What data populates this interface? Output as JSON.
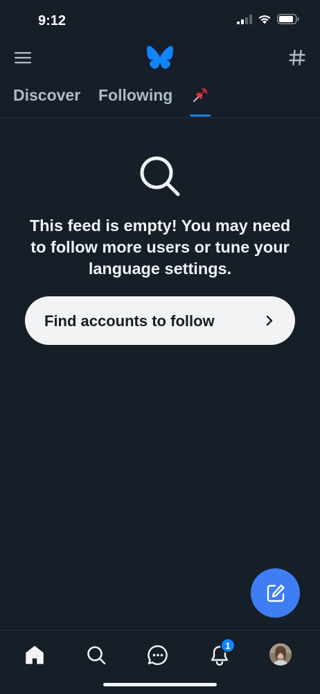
{
  "status_bar": {
    "time": "9:12",
    "icons": [
      "cellular-signal-icon",
      "wifi-icon",
      "battery-icon"
    ]
  },
  "header": {
    "menu_icon": "hamburger-menu-icon",
    "logo_icon": "butterfly-logo-icon",
    "hash_icon": "hashtag-icon"
  },
  "tabs": [
    {
      "label": "Discover",
      "active": false
    },
    {
      "label": "Following",
      "active": false
    },
    {
      "label": "",
      "icon": "pushpin-icon",
      "active": true
    }
  ],
  "empty_state": {
    "icon": "search-icon",
    "message": "This feed is empty! You may need to follow more users or tune your language settings.",
    "button_label": "Find accounts to follow"
  },
  "fab": {
    "icon": "compose-icon"
  },
  "bottom_nav": {
    "items": [
      "home-icon",
      "search-icon",
      "chat-icon",
      "bell-icon",
      "avatar"
    ],
    "notification_count": "1"
  },
  "colors": {
    "background": "#161e27",
    "accent": "#1083fe",
    "fab": "#3e7ef2",
    "text": "#f1f3f5",
    "tab_inactive": "#aebbc9"
  }
}
